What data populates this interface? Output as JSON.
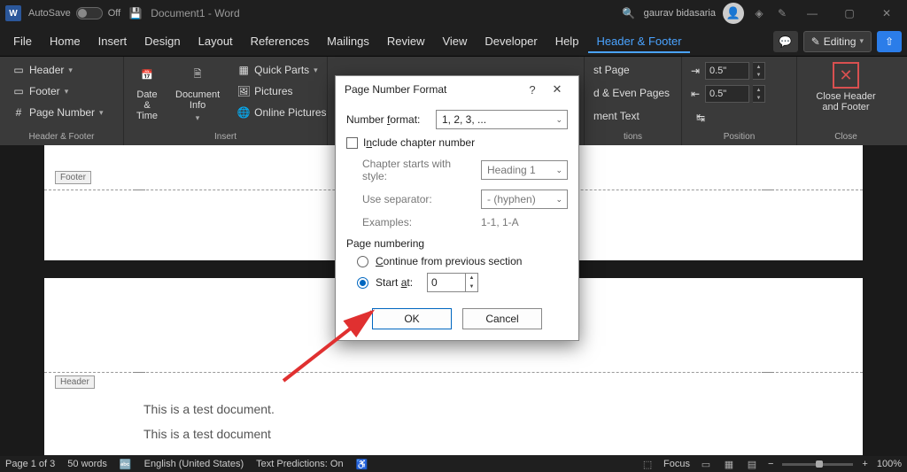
{
  "titlebar": {
    "autosave_label": "AutoSave",
    "autosave_state": "Off",
    "doc_title": "Document1 - Word",
    "user_name": "gaurav bidasaria"
  },
  "tabs": {
    "items": [
      "File",
      "Home",
      "Insert",
      "Design",
      "Layout",
      "References",
      "Mailings",
      "Review",
      "View",
      "Developer",
      "Help",
      "Header & Footer"
    ],
    "editing_label": "Editing"
  },
  "ribbon": {
    "group1": {
      "label": "Header & Footer",
      "header": "Header",
      "footer": "Footer",
      "page_number": "Page Number"
    },
    "group2": {
      "label": "Insert",
      "date_time": "Date &\nTime",
      "doc_info": "Document\nInfo",
      "quick_parts": "Quick Parts",
      "pictures": "Pictures",
      "online_pictures": "Online Pictures"
    },
    "group3_labels": {
      "first_page_suffix": "st Page",
      "even_suffix": "d & Even Pages",
      "text_suffix": "ment Text",
      "group_suffix": "tions"
    },
    "position": {
      "label": "Position",
      "top": "0.5\"",
      "bottom": "0.5\""
    },
    "close": {
      "label": "Close",
      "btn": "Close Header\nand Footer"
    }
  },
  "doc": {
    "footer_tag": "Footer",
    "header_tag": "Header",
    "line1": "This is a test document.",
    "line2": "This is a test document"
  },
  "dialog": {
    "title": "Page Number Format",
    "number_format_label": "Number format:",
    "number_format_value": "1, 2, 3, ...",
    "include_chapter": "Include chapter number",
    "chapter_style_label": "Chapter starts with style:",
    "chapter_style_value": "Heading 1",
    "use_separator_label": "Use separator:",
    "use_separator_value": "-   (hyphen)",
    "examples_label": "Examples:",
    "examples_value": "1-1, 1-A",
    "page_numbering_hdr": "Page numbering",
    "continue_label": "Continue from previous section",
    "start_at_label": "Start at:",
    "start_at_value": "0",
    "ok": "OK",
    "cancel": "Cancel"
  },
  "status": {
    "page": "Page 1 of 3",
    "words": "50 words",
    "lang": "English (United States)",
    "predictions": "Text Predictions: On",
    "focus": "Focus",
    "zoom": "100%"
  }
}
